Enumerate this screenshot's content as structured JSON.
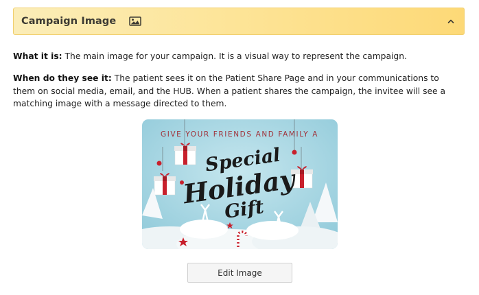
{
  "section": {
    "title": "Campaign Image",
    "icon": "image-icon",
    "toggle_icon": "chevron-up-icon"
  },
  "what": {
    "label": "What it is:",
    "text": " The main image for your campaign. It is a visual way to represent the campaign."
  },
  "when": {
    "label": "When do they see it:",
    "text": " The patient sees it on the Patient Share Page and in your communications to them on social media, email, and the HUB. When a patient shares the campaign, the invitee will see a matching image with a message directed to them."
  },
  "campaign_image": {
    "top_text": "GIVE YOUR FRIENDS AND FAMILY A",
    "line1": "Special",
    "line2": "Holiday",
    "line3": "Gift"
  },
  "button": {
    "edit_label": "Edit Image"
  },
  "colors": {
    "header_start": "#fbedb8",
    "header_end": "#fdd977",
    "image_bg": "#a8d7e3",
    "ribbon_red": "#c8202c",
    "headline_text": "#a0343c"
  }
}
